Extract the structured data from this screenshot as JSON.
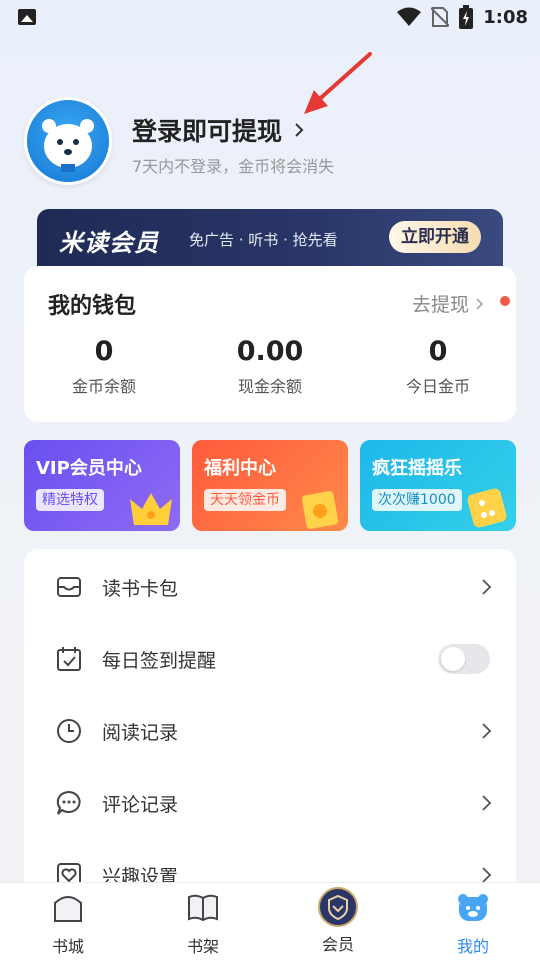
{
  "status_bar": {
    "time": "1:08"
  },
  "profile": {
    "login_title": "登录即可提现",
    "login_subtitle": "7天内不登录，金币将会消失"
  },
  "vip_banner": {
    "logo": "米读会员",
    "desc": "免广告 · 听书 · 抢先看",
    "button": "立即开通"
  },
  "wallet": {
    "title": "我的钱包",
    "link": "去提现",
    "stats": [
      {
        "value": "0",
        "label": "金币余额"
      },
      {
        "value": "0.00",
        "label": "现金余额"
      },
      {
        "value": "0",
        "label": "今日金币"
      }
    ]
  },
  "features": [
    {
      "title": "VIP会员中心",
      "tag": "精选特权",
      "color": "#7b5cf0"
    },
    {
      "title": "福利中心",
      "tag": "天天领金币",
      "color": "#ff6a3d"
    },
    {
      "title": "疯狂摇摇乐",
      "tag": "次次赚1000",
      "color": "#22c3e6"
    }
  ],
  "menu": [
    {
      "label": "读书卡包",
      "icon": "card-wallet-icon",
      "control": "chevron"
    },
    {
      "label": "每日签到提醒",
      "icon": "calendar-check-icon",
      "control": "toggle",
      "on": false
    },
    {
      "label": "阅读记录",
      "icon": "clock-icon",
      "control": "chevron"
    },
    {
      "label": "评论记录",
      "icon": "comment-icon",
      "control": "chevron"
    },
    {
      "label": "兴趣设置",
      "icon": "heart-icon",
      "control": "chevron"
    }
  ],
  "bottom_nav": [
    {
      "label": "书城",
      "icon": "bookstore-icon",
      "active": false
    },
    {
      "label": "书架",
      "icon": "bookshelf-icon",
      "active": false
    },
    {
      "label": "会员",
      "icon": "vip-shield-icon",
      "active": false
    },
    {
      "label": "我的",
      "icon": "bear-face-icon",
      "active": true
    }
  ],
  "colors": {
    "accent": "#2d8cf0",
    "vip_dark": "#1f2a55",
    "red_dot": "#f25a4a"
  }
}
